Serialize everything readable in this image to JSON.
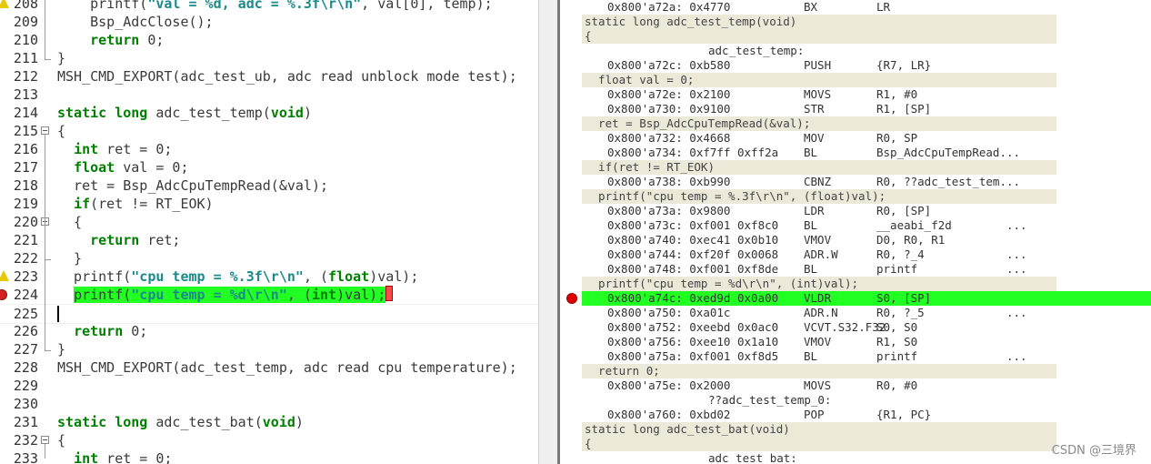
{
  "editor": {
    "lines": [
      {
        "num": "208",
        "text": "    printf(\"val = %d, adc = %.3f\\r\\n\", val[0], temp);",
        "warning": true
      },
      {
        "num": "209",
        "text": "    Bsp_AdcClose();"
      },
      {
        "num": "210",
        "text": "    return 0;"
      },
      {
        "num": "211",
        "text": "}"
      },
      {
        "num": "212",
        "text": "MSH_CMD_EXPORT(adc_test_ub, adc read unblock mode test);"
      },
      {
        "num": "213",
        "text": ""
      },
      {
        "num": "214",
        "text": "static long adc_test_temp(void)"
      },
      {
        "num": "215",
        "text": "{"
      },
      {
        "num": "216",
        "text": "  int ret = 0;"
      },
      {
        "num": "217",
        "text": "  float val = 0;"
      },
      {
        "num": "218",
        "text": "  ret = Bsp_AdcCpuTempRead(&val);"
      },
      {
        "num": "219",
        "text": "  if(ret != RT_EOK)"
      },
      {
        "num": "220",
        "text": "  {"
      },
      {
        "num": "221",
        "text": "    return ret;"
      },
      {
        "num": "222",
        "text": "  }"
      },
      {
        "num": "223",
        "text": "  printf(\"cpu temp = %.3f\\r\\n\", (float)val);",
        "warning": true
      },
      {
        "num": "224",
        "text": "  printf(\"cpu temp = %d\\r\\n\", (int)val);",
        "breakpoint": true
      },
      {
        "num": "225",
        "text": ""
      },
      {
        "num": "226",
        "text": "  return 0;"
      },
      {
        "num": "227",
        "text": "}"
      },
      {
        "num": "228",
        "text": "MSH_CMD_EXPORT(adc_test_temp, adc read cpu temperature);"
      },
      {
        "num": "229",
        "text": ""
      },
      {
        "num": "230",
        "text": ""
      },
      {
        "num": "231",
        "text": "static long adc_test_bat(void)"
      },
      {
        "num": "232",
        "text": "{"
      },
      {
        "num": "233",
        "text": "  int ret = 0;"
      }
    ]
  },
  "disassembly": {
    "rows": [
      {
        "kind": "instr",
        "addr": "0x800'a72a: 0x4770",
        "op": "BX",
        "args": "LR",
        "more": ""
      },
      {
        "kind": "src",
        "text": "static long adc_test_temp(void)"
      },
      {
        "kind": "src",
        "text": "{"
      },
      {
        "kind": "label",
        "text": "adc_test_temp:"
      },
      {
        "kind": "instr",
        "addr": "0x800'a72c: 0xb580",
        "op": "PUSH",
        "args": "{R7, LR}",
        "more": ""
      },
      {
        "kind": "src",
        "text": "  float val = 0;"
      },
      {
        "kind": "instr",
        "addr": "0x800'a72e: 0x2100",
        "op": "MOVS",
        "args": "R1, #0",
        "more": ""
      },
      {
        "kind": "instr",
        "addr": "0x800'a730: 0x9100",
        "op": "STR",
        "args": "R1, [SP]",
        "more": ""
      },
      {
        "kind": "src",
        "text": "  ret = Bsp_AdcCpuTempRead(&val);"
      },
      {
        "kind": "instr",
        "addr": "0x800'a732: 0x4668",
        "op": "MOV",
        "args": "R0, SP",
        "more": ""
      },
      {
        "kind": "instr",
        "addr": "0x800'a734: 0xf7ff 0xff2a",
        "op": "BL",
        "args": "Bsp_AdcCpuTempRead...",
        "more": ""
      },
      {
        "kind": "src",
        "text": "  if(ret != RT_EOK)"
      },
      {
        "kind": "instr",
        "addr": "0x800'a738: 0xb990",
        "op": "CBNZ",
        "args": "R0, ??adc_test_tem...",
        "more": ""
      },
      {
        "kind": "src",
        "text": "  printf(\"cpu temp = %.3f\\r\\n\", (float)val);"
      },
      {
        "kind": "instr",
        "addr": "0x800'a73a: 0x9800",
        "op": "LDR",
        "args": "R0, [SP]",
        "more": ""
      },
      {
        "kind": "instr",
        "addr": "0x800'a73c: 0xf001 0xf8c0",
        "op": "BL",
        "args": "__aeabi_f2d",
        "more": "..."
      },
      {
        "kind": "instr",
        "addr": "0x800'a740: 0xec41 0x0b10",
        "op": "VMOV",
        "args": "D0, R0, R1",
        "more": ""
      },
      {
        "kind": "instr",
        "addr": "0x800'a744: 0xf20f 0x0068",
        "op": "ADR.W",
        "args": "R0, ?_4",
        "more": "..."
      },
      {
        "kind": "instr",
        "addr": "0x800'a748: 0xf001 0xf8de",
        "op": "BL",
        "args": "printf",
        "more": "..."
      },
      {
        "kind": "src",
        "text": "  printf(\"cpu temp = %d\\r\\n\", (int)val);"
      },
      {
        "kind": "current",
        "addr": "0x800'a74c: 0xed9d 0x0a00",
        "op": "VLDR",
        "args": "S0, [SP]",
        "more": ""
      },
      {
        "kind": "instr",
        "addr": "0x800'a750: 0xa01c",
        "op": "ADR.N",
        "args": "R0, ?_5",
        "more": "..."
      },
      {
        "kind": "instr",
        "addr": "0x800'a752: 0xeebd 0x0ac0",
        "op": "VCVT.S32.F32",
        "args": "S0, S0",
        "more": ""
      },
      {
        "kind": "instr",
        "addr": "0x800'a756: 0xee10 0x1a10",
        "op": "VMOV",
        "args": "R1, S0",
        "more": ""
      },
      {
        "kind": "instr",
        "addr": "0x800'a75a: 0xf001 0xf8d5",
        "op": "BL",
        "args": "printf",
        "more": "..."
      },
      {
        "kind": "src",
        "text": "  return 0;"
      },
      {
        "kind": "instr",
        "addr": "0x800'a75e: 0x2000",
        "op": "MOVS",
        "args": "R0, #0",
        "more": ""
      },
      {
        "kind": "label",
        "text": "??adc_test_temp_0:"
      },
      {
        "kind": "instr",
        "addr": "0x800'a760: 0xbd02",
        "op": "POP",
        "args": "{R1, PC}",
        "more": ""
      },
      {
        "kind": "src",
        "text": "static long adc_test_bat(void)"
      },
      {
        "kind": "src",
        "text": "{"
      },
      {
        "kind": "label",
        "text": "adc_test_bat:"
      }
    ]
  },
  "watermark": "CSDN @三境界",
  "colors": {
    "current_line": "#22ff22",
    "breakpoint": "#dd0000",
    "keyword": "#008000",
    "string": "#1a8a8a"
  }
}
